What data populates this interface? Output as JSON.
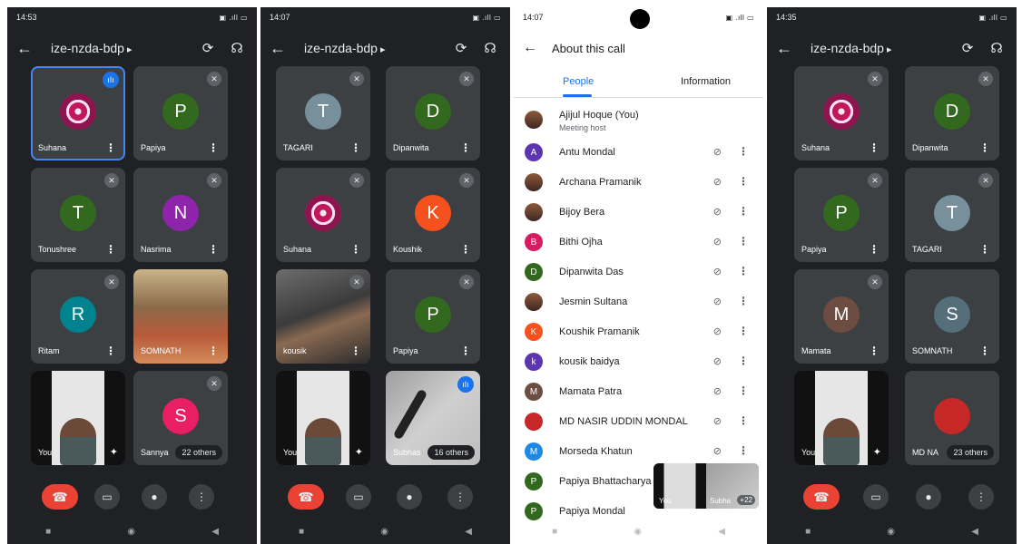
{
  "screen1": {
    "time": "14:53",
    "title": "ize-nzda-bdp",
    "tiles": [
      {
        "name": "Suhana",
        "avatar": "",
        "color": "#c2185b"
      },
      {
        "name": "Papiya",
        "avatar": "P",
        "color": "#33691e"
      },
      {
        "name": "Tonushree",
        "avatar": "T",
        "color": "#33691e"
      },
      {
        "name": "Nasrima",
        "avatar": "N",
        "color": "#8e24aa"
      },
      {
        "name": "Ritam",
        "avatar": "R",
        "color": "#00838f"
      },
      {
        "name": "SOMNATH",
        "avatar": "",
        "color": "#8b6a4a"
      },
      {
        "name": "You",
        "avatar": "",
        "color": "#e6e6e6"
      },
      {
        "name": "Sannya",
        "avatar": "S",
        "color": "#e91e63"
      }
    ],
    "others": "22 others"
  },
  "screen2": {
    "time": "14:07",
    "title": "ize-nzda-bdp",
    "tiles": [
      {
        "name": "TAGARI",
        "avatar": "T",
        "color": "#78909c"
      },
      {
        "name": "Dipanwita",
        "avatar": "D",
        "color": "#33691e"
      },
      {
        "name": "Suhana",
        "avatar": "",
        "color": "#c2185b"
      },
      {
        "name": "Koushik",
        "avatar": "K",
        "color": "#f4511e"
      },
      {
        "name": "kousik",
        "avatar": "",
        "color": "#3b3b3b"
      },
      {
        "name": "Papiya",
        "avatar": "P",
        "color": "#33691e"
      },
      {
        "name": "You",
        "avatar": "",
        "color": "#e6e6e6"
      },
      {
        "name": "Subhas",
        "avatar": "",
        "color": "#bdbdbd"
      }
    ],
    "others": "16 others"
  },
  "screen3": {
    "time": "14:07",
    "title": "About this call",
    "tabs": [
      "People",
      "Information"
    ],
    "people": [
      {
        "name": "Ajijul Hoque (You)",
        "sub": "Meeting host",
        "avatar": "",
        "color": "#6d4c41"
      },
      {
        "name": "Antu Mondal",
        "avatar": "A",
        "color": "#5e35b1"
      },
      {
        "name": "Archana Pramanik",
        "avatar": "",
        "color": "#5d4037"
      },
      {
        "name": "Bijoy Bera",
        "avatar": "",
        "color": "#5d4037"
      },
      {
        "name": "Bithi Ojha",
        "avatar": "B",
        "color": "#d81b60"
      },
      {
        "name": "Dipanwita Das",
        "avatar": "D",
        "color": "#33691e"
      },
      {
        "name": "Jesmin Sultana",
        "avatar": "",
        "color": "#5d4037"
      },
      {
        "name": "Koushik Pramanik",
        "avatar": "K",
        "color": "#f4511e"
      },
      {
        "name": "kousik baidya",
        "avatar": "k",
        "color": "#5e35b1"
      },
      {
        "name": "Mamata Patra",
        "avatar": "M",
        "color": "#6d4c41"
      },
      {
        "name": "MD NASIR UDDIN MONDAL",
        "avatar": "",
        "color": "#c62828"
      },
      {
        "name": "Morseda Khatun",
        "avatar": "M",
        "color": "#1e88e5"
      },
      {
        "name": "Papiya Bhattacharya",
        "avatar": "P",
        "color": "#33691e"
      },
      {
        "name": "Papiya Mondal",
        "avatar": "P",
        "color": "#33691e"
      }
    ],
    "pip": {
      "left": "You",
      "right": "Subha",
      "count": "+22"
    }
  },
  "screen4": {
    "time": "14:35",
    "title": "ize-nzda-bdp",
    "tiles": [
      {
        "name": "Suhana",
        "avatar": "",
        "color": "#c2185b"
      },
      {
        "name": "Dipanwita",
        "avatar": "D",
        "color": "#33691e"
      },
      {
        "name": "Papiya",
        "avatar": "P",
        "color": "#33691e"
      },
      {
        "name": "TAGARI",
        "avatar": "T",
        "color": "#78909c"
      },
      {
        "name": "Mamata",
        "avatar": "M",
        "color": "#6d4c41"
      },
      {
        "name": "SOMNATH",
        "avatar": "S",
        "color": "#546e7a"
      },
      {
        "name": "You",
        "avatar": "",
        "color": "#e6e6e6"
      },
      {
        "name": "MD NA",
        "avatar": "",
        "color": "#c62828"
      }
    ],
    "others": "23 others"
  }
}
